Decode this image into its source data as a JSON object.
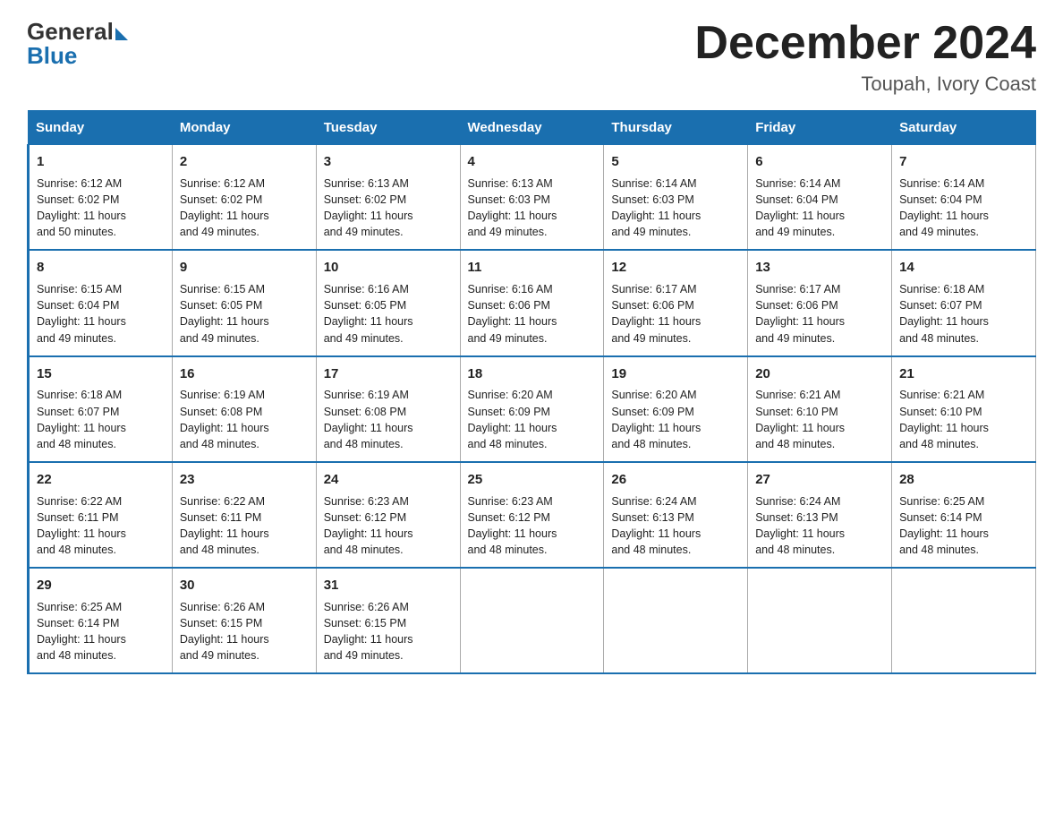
{
  "logo": {
    "general": "General",
    "blue": "Blue"
  },
  "title": "December 2024",
  "location": "Toupah, Ivory Coast",
  "days_of_week": [
    "Sunday",
    "Monday",
    "Tuesday",
    "Wednesday",
    "Thursday",
    "Friday",
    "Saturday"
  ],
  "weeks": [
    [
      {
        "day": "1",
        "sunrise": "6:12 AM",
        "sunset": "6:02 PM",
        "daylight": "11 hours and 50 minutes."
      },
      {
        "day": "2",
        "sunrise": "6:12 AM",
        "sunset": "6:02 PM",
        "daylight": "11 hours and 49 minutes."
      },
      {
        "day": "3",
        "sunrise": "6:13 AM",
        "sunset": "6:02 PM",
        "daylight": "11 hours and 49 minutes."
      },
      {
        "day": "4",
        "sunrise": "6:13 AM",
        "sunset": "6:03 PM",
        "daylight": "11 hours and 49 minutes."
      },
      {
        "day": "5",
        "sunrise": "6:14 AM",
        "sunset": "6:03 PM",
        "daylight": "11 hours and 49 minutes."
      },
      {
        "day": "6",
        "sunrise": "6:14 AM",
        "sunset": "6:04 PM",
        "daylight": "11 hours and 49 minutes."
      },
      {
        "day": "7",
        "sunrise": "6:14 AM",
        "sunset": "6:04 PM",
        "daylight": "11 hours and 49 minutes."
      }
    ],
    [
      {
        "day": "8",
        "sunrise": "6:15 AM",
        "sunset": "6:04 PM",
        "daylight": "11 hours and 49 minutes."
      },
      {
        "day": "9",
        "sunrise": "6:15 AM",
        "sunset": "6:05 PM",
        "daylight": "11 hours and 49 minutes."
      },
      {
        "day": "10",
        "sunrise": "6:16 AM",
        "sunset": "6:05 PM",
        "daylight": "11 hours and 49 minutes."
      },
      {
        "day": "11",
        "sunrise": "6:16 AM",
        "sunset": "6:06 PM",
        "daylight": "11 hours and 49 minutes."
      },
      {
        "day": "12",
        "sunrise": "6:17 AM",
        "sunset": "6:06 PM",
        "daylight": "11 hours and 49 minutes."
      },
      {
        "day": "13",
        "sunrise": "6:17 AM",
        "sunset": "6:06 PM",
        "daylight": "11 hours and 49 minutes."
      },
      {
        "day": "14",
        "sunrise": "6:18 AM",
        "sunset": "6:07 PM",
        "daylight": "11 hours and 48 minutes."
      }
    ],
    [
      {
        "day": "15",
        "sunrise": "6:18 AM",
        "sunset": "6:07 PM",
        "daylight": "11 hours and 48 minutes."
      },
      {
        "day": "16",
        "sunrise": "6:19 AM",
        "sunset": "6:08 PM",
        "daylight": "11 hours and 48 minutes."
      },
      {
        "day": "17",
        "sunrise": "6:19 AM",
        "sunset": "6:08 PM",
        "daylight": "11 hours and 48 minutes."
      },
      {
        "day": "18",
        "sunrise": "6:20 AM",
        "sunset": "6:09 PM",
        "daylight": "11 hours and 48 minutes."
      },
      {
        "day": "19",
        "sunrise": "6:20 AM",
        "sunset": "6:09 PM",
        "daylight": "11 hours and 48 minutes."
      },
      {
        "day": "20",
        "sunrise": "6:21 AM",
        "sunset": "6:10 PM",
        "daylight": "11 hours and 48 minutes."
      },
      {
        "day": "21",
        "sunrise": "6:21 AM",
        "sunset": "6:10 PM",
        "daylight": "11 hours and 48 minutes."
      }
    ],
    [
      {
        "day": "22",
        "sunrise": "6:22 AM",
        "sunset": "6:11 PM",
        "daylight": "11 hours and 48 minutes."
      },
      {
        "day": "23",
        "sunrise": "6:22 AM",
        "sunset": "6:11 PM",
        "daylight": "11 hours and 48 minutes."
      },
      {
        "day": "24",
        "sunrise": "6:23 AM",
        "sunset": "6:12 PM",
        "daylight": "11 hours and 48 minutes."
      },
      {
        "day": "25",
        "sunrise": "6:23 AM",
        "sunset": "6:12 PM",
        "daylight": "11 hours and 48 minutes."
      },
      {
        "day": "26",
        "sunrise": "6:24 AM",
        "sunset": "6:13 PM",
        "daylight": "11 hours and 48 minutes."
      },
      {
        "day": "27",
        "sunrise": "6:24 AM",
        "sunset": "6:13 PM",
        "daylight": "11 hours and 48 minutes."
      },
      {
        "day": "28",
        "sunrise": "6:25 AM",
        "sunset": "6:14 PM",
        "daylight": "11 hours and 48 minutes."
      }
    ],
    [
      {
        "day": "29",
        "sunrise": "6:25 AM",
        "sunset": "6:14 PM",
        "daylight": "11 hours and 48 minutes."
      },
      {
        "day": "30",
        "sunrise": "6:26 AM",
        "sunset": "6:15 PM",
        "daylight": "11 hours and 49 minutes."
      },
      {
        "day": "31",
        "sunrise": "6:26 AM",
        "sunset": "6:15 PM",
        "daylight": "11 hours and 49 minutes."
      },
      null,
      null,
      null,
      null
    ]
  ],
  "labels": {
    "sunrise": "Sunrise:",
    "sunset": "Sunset:",
    "daylight": "Daylight:"
  }
}
